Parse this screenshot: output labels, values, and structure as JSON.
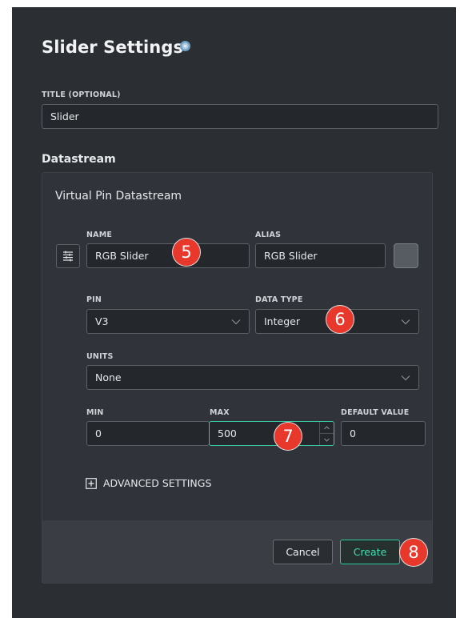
{
  "header": {
    "title": "Slider Settings",
    "info_icon": "info-icon"
  },
  "title_field": {
    "label": "TITLE (OPTIONAL)",
    "value": "Slider"
  },
  "datastream": {
    "section_label": "Datastream",
    "card_title": "Virtual Pin Datastream",
    "settings_icon": "sliders-icon",
    "name": {
      "label": "NAME",
      "value": "RGB Slider"
    },
    "alias": {
      "label": "ALIAS",
      "value": "RGB Slider"
    },
    "pin": {
      "label": "PIN",
      "value": "V3"
    },
    "data_type": {
      "label": "DATA TYPE",
      "value": "Integer"
    },
    "units": {
      "label": "UNITS",
      "value": "None"
    },
    "min": {
      "label": "MIN",
      "value": "0"
    },
    "max": {
      "label": "MAX",
      "value": "500"
    },
    "default_value": {
      "label": "DEFAULT VALUE",
      "value": "0"
    },
    "advanced": {
      "label": "ADVANCED SETTINGS",
      "icon": "plus-square-icon"
    }
  },
  "footer": {
    "cancel_label": "Cancel",
    "create_label": "Create"
  },
  "badges": {
    "name": "5",
    "data_type": "6",
    "max": "7",
    "create": "8"
  },
  "colors": {
    "accent": "#2ec99a",
    "badge": "#e8382c",
    "background": "#2b2e33"
  }
}
